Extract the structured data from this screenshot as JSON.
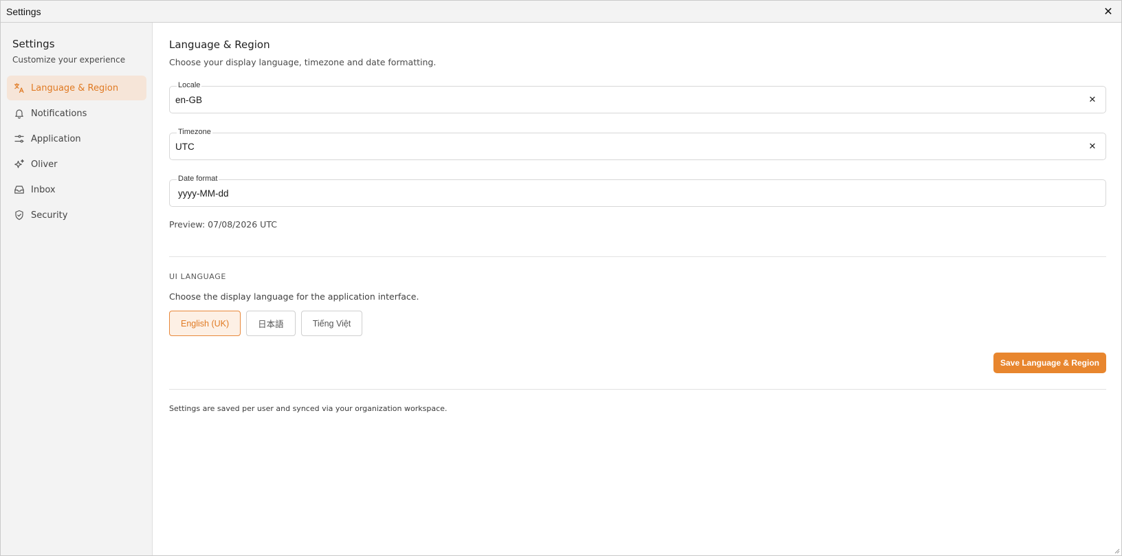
{
  "window": {
    "title": "Settings",
    "close_glyph": "✕"
  },
  "sidebar": {
    "title": "Settings",
    "subtitle": "Customize your experience",
    "items": [
      {
        "label": "Language & Region",
        "icon": "translate-icon",
        "active": true
      },
      {
        "label": "Notifications",
        "icon": "bell-icon",
        "active": false
      },
      {
        "label": "Application",
        "icon": "sliders-icon",
        "active": false
      },
      {
        "label": "Oliver",
        "icon": "sparkle-icon",
        "active": false
      },
      {
        "label": "Inbox",
        "icon": "inbox-icon",
        "active": false
      },
      {
        "label": "Security",
        "icon": "shield-icon",
        "active": false
      }
    ]
  },
  "main": {
    "title": "Language & Region",
    "description": "Choose your display language, timezone and date formatting.",
    "fields": {
      "locale": {
        "label": "Locale",
        "value": "en-GB"
      },
      "timezone": {
        "label": "Timezone",
        "value": "UTC"
      },
      "date_format": {
        "label": "Date format",
        "value": "yyyy-MM-dd"
      }
    },
    "preview": "Preview: 07/08/2026 UTC",
    "ui_language": {
      "overline": "UI LANGUAGE",
      "description": "Choose the display language for the application interface.",
      "options": [
        {
          "label": "English (UK)",
          "selected": true
        },
        {
          "label": "日本語",
          "selected": false
        },
        {
          "label": "Tiếng Việt",
          "selected": false
        }
      ]
    },
    "save_label": "Save Language & Region",
    "footer_note": "Settings are saved per user and synced via your organization workspace.",
    "clear_glyph": "✕"
  },
  "colors": {
    "accent": "#e8862e",
    "accent_text": "#e07a23",
    "active_bg": "#f6e5d8",
    "sidebar_bg": "#f3f3f3"
  }
}
